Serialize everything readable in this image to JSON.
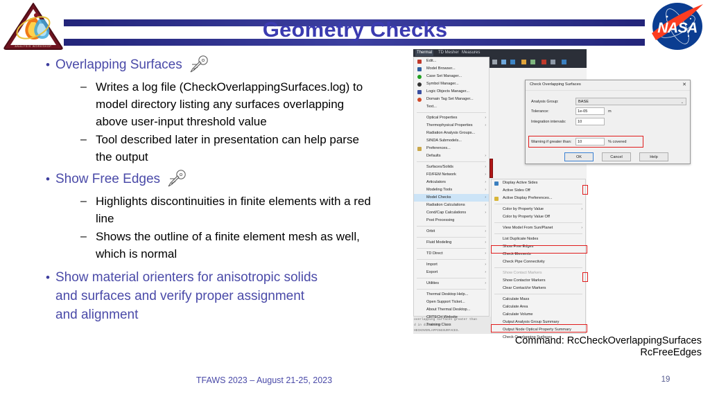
{
  "slide": {
    "title": "Geometry Checks",
    "footer": "TFAWS 2023 – August 21-25, 2023",
    "page_number": "19",
    "accent_color": "#3b3bb0",
    "bullet_color": "#4a4aa8",
    "highlight_color": "#e01b1b"
  },
  "logos": {
    "left": "tfaws-logo",
    "left_text": "THERMAL & FLUIDS ANALYSIS WORKSHOP",
    "right": "nasa-logo",
    "right_text": "NASA"
  },
  "bullets": [
    {
      "level": 1,
      "text": "Overlapping Surfaces",
      "icon": "comet-icon",
      "children": [
        "Writes a log file (CheckOverlappingSurfaces.log) to model directory listing any surfaces overlapping above user-input threshold value",
        "Tool described later in presentation can help parse the output"
      ]
    },
    {
      "level": 1,
      "text": "Show Free Edges",
      "icon": "comet-icon",
      "children": [
        "Highlights discontinuities in finite elements with a red line",
        "Shows the outline of a finite element mesh as well, which is normal"
      ]
    },
    {
      "level": 1,
      "text": "Show material orienters for anisotropic solids and surfaces and verify proper assignment and alignment",
      "icon": "",
      "children": []
    }
  ],
  "caption": {
    "line1": "Command: RcCheckOverlappingSurfaces",
    "line2": "RcFreeEdges"
  },
  "app": {
    "menubar": [
      "Thermal",
      "TD Mesher",
      "Measures"
    ],
    "menubar_active": "Thermal",
    "menu_thermal": [
      {
        "label": "Edit...",
        "icon": "edit-icon",
        "icon_color": "#c0392b",
        "arrow": false
      },
      {
        "label": "Model Browser...",
        "icon": "browser-icon",
        "icon_color": "#2e5f9e",
        "arrow": false
      },
      {
        "label": "Case Set Manager...",
        "icon": "case-set-icon",
        "icon_color": "#21a021",
        "arrow": false
      },
      {
        "label": "Symbol Manager...",
        "icon": "symbol-icon",
        "icon_color": "#333333",
        "arrow": false
      },
      {
        "label": "Logic Objects Manager...",
        "icon": "logic-icon",
        "icon_color": "#3a4fa0",
        "arrow": false
      },
      {
        "label": "Domain Tag Set Manager...",
        "icon": "domain-tag-icon",
        "icon_color": "#d04a2a",
        "arrow": false
      },
      {
        "label": "Text...",
        "icon": "",
        "icon_color": "",
        "arrow": false
      },
      {
        "sep": true
      },
      {
        "label": "Optical Properties",
        "icon": "",
        "icon_color": "",
        "arrow": true
      },
      {
        "label": "Thermophysical Properties",
        "icon": "",
        "icon_color": "",
        "arrow": true
      },
      {
        "label": "Radiation Analysis Groups...",
        "icon": "",
        "icon_color": "",
        "arrow": false
      },
      {
        "label": "SINDA Submodels...",
        "icon": "",
        "icon_color": "",
        "arrow": false
      },
      {
        "label": "Preferences...",
        "icon": "prefs-icon",
        "icon_color": "#caa84a",
        "arrow": false
      },
      {
        "label": "Defaults",
        "icon": "",
        "icon_color": "",
        "arrow": true
      },
      {
        "sep": true
      },
      {
        "label": "Surfaces/Solids",
        "icon": "",
        "icon_color": "",
        "arrow": true
      },
      {
        "label": "FD/FEM Network",
        "icon": "",
        "icon_color": "",
        "arrow": true
      },
      {
        "label": "Articulators",
        "icon": "",
        "icon_color": "",
        "arrow": true
      },
      {
        "label": "Modeling Tools",
        "icon": "",
        "icon_color": "",
        "arrow": true
      },
      {
        "label": "Model Checks",
        "icon": "",
        "icon_color": "",
        "arrow": true,
        "selected": true
      },
      {
        "label": "Radiation Calculations",
        "icon": "",
        "icon_color": "",
        "arrow": true
      },
      {
        "label": "Cond/Cap Calculations",
        "icon": "",
        "icon_color": "",
        "arrow": true
      },
      {
        "label": "Post Processing",
        "icon": "",
        "icon_color": "",
        "arrow": false
      },
      {
        "sep": true
      },
      {
        "label": "Orbit",
        "icon": "",
        "icon_color": "",
        "arrow": true
      },
      {
        "sep": true
      },
      {
        "label": "Fluid Modeling",
        "icon": "",
        "icon_color": "",
        "arrow": true
      },
      {
        "sep": true
      },
      {
        "label": "TD Direct",
        "icon": "",
        "icon_color": "",
        "arrow": true
      },
      {
        "sep": true
      },
      {
        "label": "Import",
        "icon": "",
        "icon_color": "",
        "arrow": true
      },
      {
        "label": "Export",
        "icon": "",
        "icon_color": "",
        "arrow": true
      },
      {
        "sep": true
      },
      {
        "label": "Utilities",
        "icon": "",
        "icon_color": "",
        "arrow": true
      },
      {
        "sep": true
      },
      {
        "label": "Thermal Desktop Help...",
        "icon": "",
        "icon_color": "",
        "arrow": false
      },
      {
        "label": "Open Support Ticket...",
        "icon": "",
        "icon_color": "",
        "arrow": false
      },
      {
        "label": "About Thermal Desktop...",
        "icon": "",
        "icon_color": "",
        "arrow": false
      },
      {
        "label": "CRTECH Website",
        "icon": "",
        "icon_color": "",
        "arrow": false
      },
      {
        "label": "Training Class",
        "icon": "",
        "icon_color": "",
        "arrow": false
      }
    ],
    "menu_model_checks": [
      {
        "label": "Display Active Sides",
        "icon": "display-sides-icon",
        "icon_color": "#3a7fbf",
        "arrow": false
      },
      {
        "label": "Active Sides Off",
        "icon": "",
        "icon_color": "",
        "arrow": false
      },
      {
        "label": "Active Display Preferences...",
        "icon": "display-prefs-icon",
        "icon_color": "#d8b63a",
        "arrow": false
      },
      {
        "sep": true
      },
      {
        "label": "Color by Property Value",
        "icon": "",
        "icon_color": "",
        "arrow": true
      },
      {
        "label": "Color by Property Value Off",
        "icon": "",
        "icon_color": "",
        "arrow": false
      },
      {
        "sep": true
      },
      {
        "label": "View Model From Sun/Planet",
        "icon": "",
        "icon_color": "",
        "arrow": true
      },
      {
        "sep": true
      },
      {
        "label": "List Duplicate Nodes",
        "icon": "",
        "icon_color": "",
        "arrow": false
      },
      {
        "label": "Show Free Edges",
        "icon": "",
        "icon_color": "",
        "arrow": false,
        "highlight": true
      },
      {
        "label": "Check Elements",
        "icon": "",
        "icon_color": "",
        "arrow": false
      },
      {
        "label": "Check Pipe Connectivity",
        "icon": "",
        "icon_color": "",
        "arrow": false
      },
      {
        "sep": true
      },
      {
        "label": "Show Contact Markers",
        "icon": "",
        "icon_color": "",
        "arrow": false,
        "disabled": true
      },
      {
        "label": "Show Contactor Markers",
        "icon": "",
        "icon_color": "",
        "arrow": false
      },
      {
        "label": "Clear Contact/or Markers",
        "icon": "",
        "icon_color": "",
        "arrow": false
      },
      {
        "sep": true
      },
      {
        "label": "Calculate Mass",
        "icon": "",
        "icon_color": "",
        "arrow": false
      },
      {
        "label": "Calculate Area",
        "icon": "",
        "icon_color": "",
        "arrow": false
      },
      {
        "label": "Calculate Volume",
        "icon": "",
        "icon_color": "",
        "arrow": false
      },
      {
        "label": "Output Analysis Group Summary",
        "icon": "",
        "icon_color": "",
        "arrow": false
      },
      {
        "label": "Output Node Optical Property Summary",
        "icon": "",
        "icon_color": "",
        "arrow": false
      },
      {
        "label": "Check Overlapping Surfaces",
        "icon": "",
        "icon_color": "",
        "arrow": false,
        "highlight": true
      }
    ],
    "console": [
      "overlapping surfaces greater than",
      "d in directory",
      "HECKOVERLAPPINGSURFACES."
    ],
    "dialog": {
      "title": "Check Overlapping Surfaces",
      "close": "✕",
      "fields": [
        {
          "label": "Analysis Group:",
          "value": "BASE",
          "unit": "",
          "type": "combo"
        },
        {
          "label": "Tolerance:",
          "value": "1e-05",
          "unit": "m",
          "type": "input"
        },
        {
          "label": "Integration intervals:",
          "value": "10",
          "unit": "",
          "type": "input"
        },
        {
          "label": "Warning if greater than:",
          "value": "10",
          "unit": "% covered",
          "type": "input",
          "highlight": true
        }
      ],
      "buttons": [
        "OK",
        "Cancel",
        "Help"
      ]
    }
  }
}
